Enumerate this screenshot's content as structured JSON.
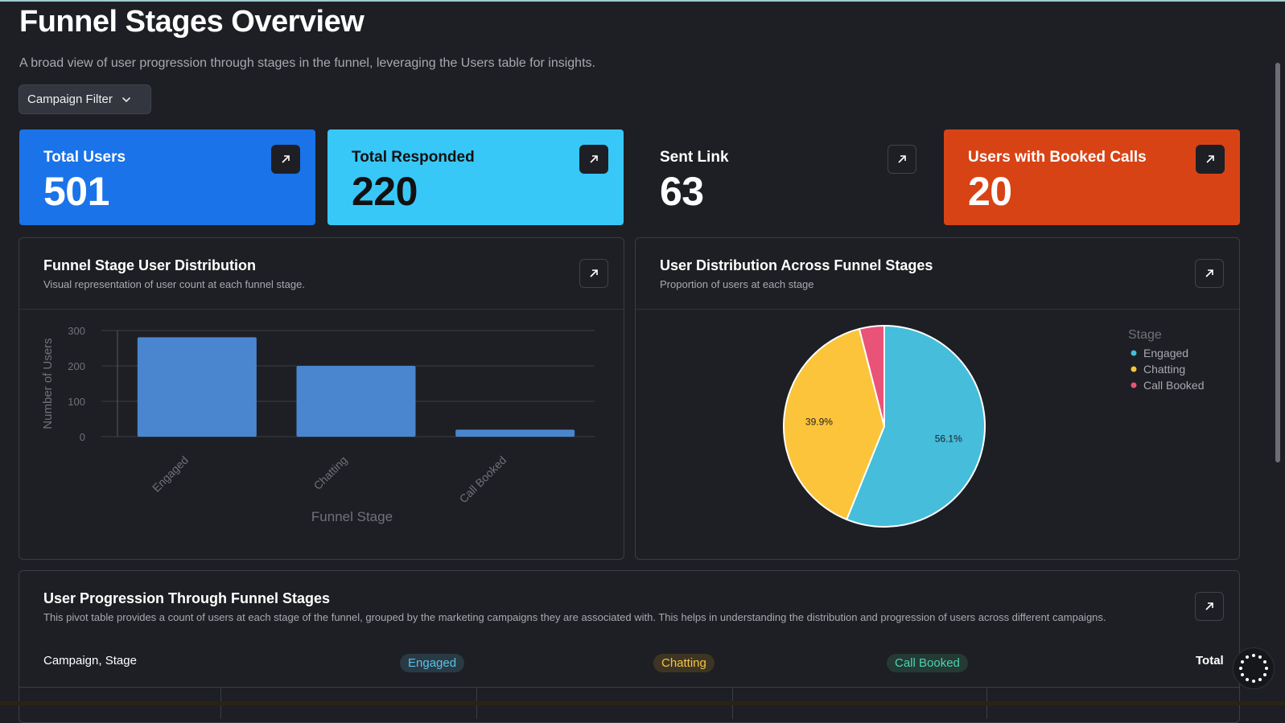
{
  "page": {
    "title": "Funnel Stages Overview",
    "subtitle": "A broad view of user progression through stages in the funnel, leveraging the Users table for insights.",
    "filter_label": "Campaign Filter"
  },
  "kpis": [
    {
      "label": "Total Users",
      "value": "501",
      "color": "#1a73e8"
    },
    {
      "label": "Total Responded",
      "value": "220",
      "color": "#38c8f8"
    },
    {
      "label": "Sent Link",
      "value": "63",
      "color": "transparent"
    },
    {
      "label": "Users with Booked Calls",
      "value": "20",
      "color": "#d84315"
    }
  ],
  "bar_card": {
    "title": "Funnel Stage User Distribution",
    "subtitle": "Visual representation of user count at each funnel stage."
  },
  "pie_card": {
    "title": "User Distribution Across Funnel Stages",
    "subtitle": "Proportion of users at each stage"
  },
  "table_card": {
    "title": "User Progression Through Funnel Stages",
    "subtitle": "This pivot table provides a count of users at each stage of the funnel, grouped by the marketing campaigns they are associated with. This helps in understanding the distribution and progression of users across different campaigns.",
    "columns": [
      "Campaign, Stage",
      "Engaged",
      "Chatting",
      "Call Booked",
      "Total"
    ]
  },
  "chart_data": [
    {
      "type": "bar",
      "categories": [
        "Engaged",
        "Chatting",
        "Call Booked"
      ],
      "values": [
        281,
        200,
        20
      ],
      "xlabel": "Funnel Stage",
      "ylabel": "Number of Users",
      "ylim": [
        0,
        300
      ],
      "yticks": [
        0,
        100,
        200,
        300
      ],
      "color": "#4a86d0",
      "grid": true
    },
    {
      "type": "pie",
      "labels": [
        "Engaged",
        "Chatting",
        "Call Booked"
      ],
      "values": [
        56.1,
        39.9,
        4.0
      ],
      "display_labels": [
        "56.1%",
        "39.9%",
        ""
      ],
      "colors": [
        "#45bddb",
        "#fbc43a",
        "#e95377"
      ],
      "legend_title": "Stage",
      "legend_position": "right"
    }
  ],
  "colors": {
    "background": "#1e1f24",
    "accent_blue": "#1a73e8",
    "accent_cyan": "#38c8f8",
    "accent_orange": "#d84315"
  }
}
